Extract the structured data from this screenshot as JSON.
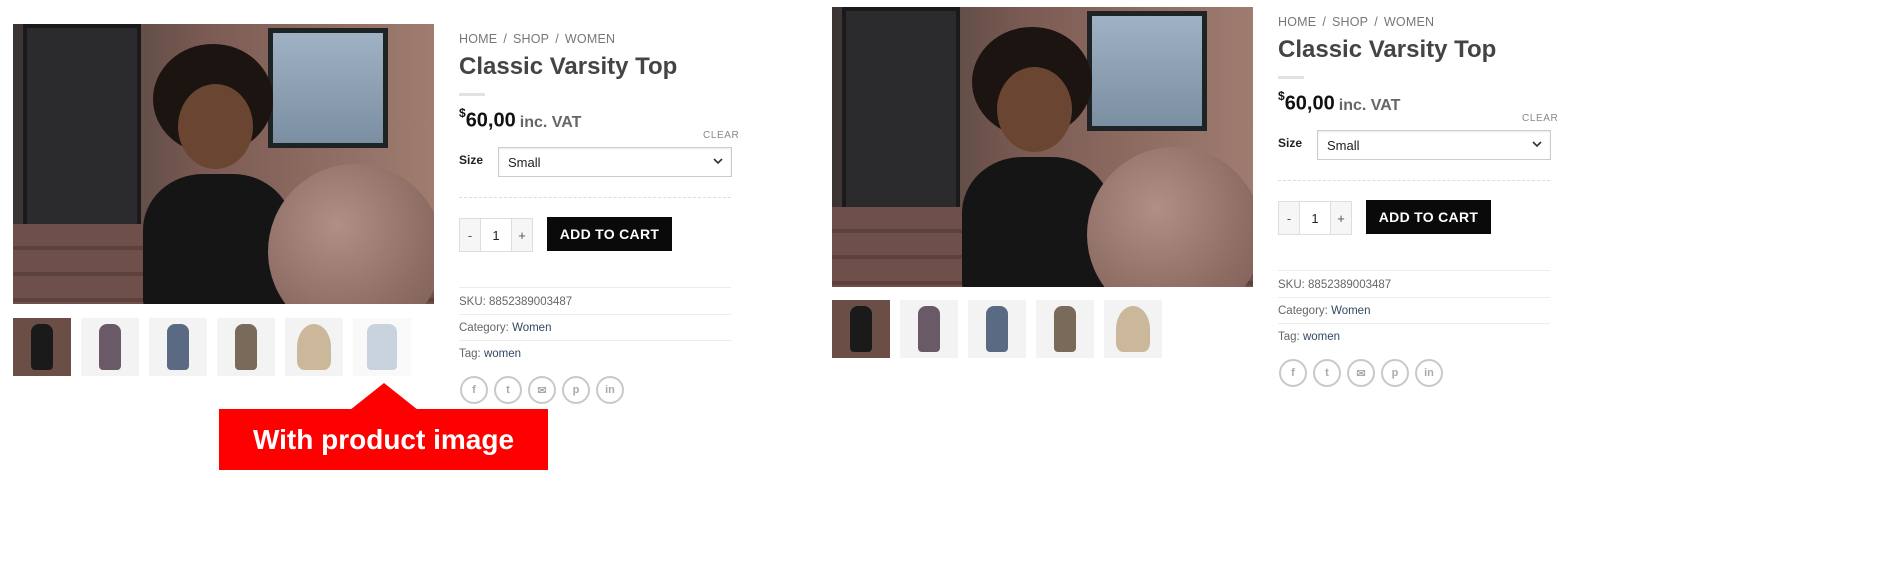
{
  "left": {
    "breadcrumb": [
      "HOME",
      "SHOP",
      "WOMEN"
    ],
    "separator": "/",
    "title": "Classic Varsity Top",
    "price": {
      "currency": "$",
      "amount": "60,00",
      "suffix": "inc. VAT"
    },
    "clear_label": "CLEAR",
    "size_label": "Size",
    "size_value": "Small",
    "qty": {
      "minus": "-",
      "value": "1",
      "plus": "+"
    },
    "add_to_cart": "ADD TO CART",
    "sku": "SKU: 8852389003487",
    "category_label": "Category:",
    "category_value": "Women",
    "tag_label": "Tag:",
    "tag_value": "women",
    "socials": [
      "facebook-icon",
      "twitter-icon",
      "email-icon",
      "pinterest-icon",
      "linkedin-icon"
    ]
  },
  "right": {
    "breadcrumb": [
      "HOME",
      "SHOP",
      "WOMEN"
    ],
    "separator": "/",
    "title": "Classic Varsity Top",
    "price": {
      "currency": "$",
      "amount": "60,00",
      "suffix": "inc. VAT"
    },
    "clear_label": "CLEAR",
    "size_label": "Size",
    "size_value": "Small",
    "qty": {
      "minus": "-",
      "value": "1",
      "plus": "+"
    },
    "add_to_cart": "ADD TO CART",
    "sku": "SKU: 8852389003487",
    "category_label": "Category:",
    "category_value": "Women",
    "tag_label": "Tag:",
    "tag_value": "women",
    "socials": [
      "facebook-icon",
      "twitter-icon",
      "email-icon",
      "pinterest-icon",
      "linkedin-icon"
    ]
  },
  "callout": "With product image",
  "colors": {
    "accent": "#ff0000",
    "cart": "#0a0a0a",
    "link": "#334862"
  }
}
